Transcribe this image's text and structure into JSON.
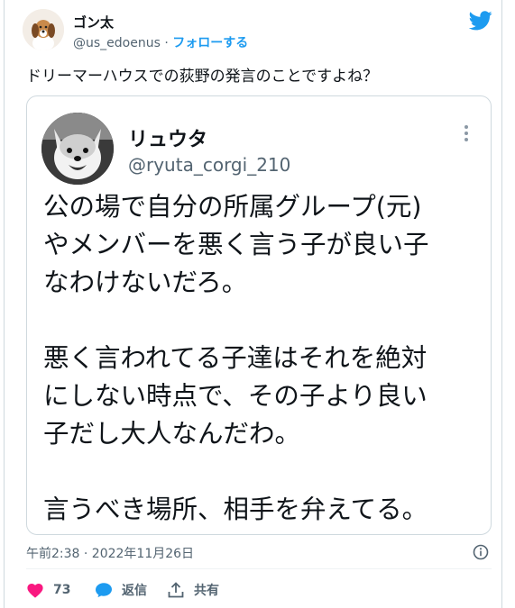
{
  "author": {
    "name": "ゴン太",
    "handle": "@us_edoenus",
    "separator": "·",
    "follow_label": "フォローする"
  },
  "tweet": {
    "text": "ドリーマーハウスでの荻野の発言のことですよね？"
  },
  "quoted": {
    "name": "リュウタ",
    "handle": "@ryuta_corgi_210",
    "lines": [
      "公の場で自分の所属グループ(元)",
      "やメンバーを悪く言う子が良い子",
      "なわけないだろ。",
      "",
      "悪く言われてる子達はそれを絶対",
      "にしない時点で、その子より良い",
      "子だし大人なんだわ。",
      "",
      "言うべき場所、相手を弁えてる。"
    ]
  },
  "meta": {
    "timestamp": "午前2:38 · 2022年11月26日"
  },
  "actions": {
    "like_count": "73",
    "reply_label": "返信",
    "share_label": "共有"
  },
  "colors": {
    "accent": "#1d9bf0",
    "like": "#f91880",
    "muted": "#536471",
    "border": "#cfd9de"
  },
  "icons": [
    "twitter-bird-icon",
    "more-icon",
    "info-icon",
    "heart-icon",
    "reply-icon",
    "share-icon"
  ]
}
